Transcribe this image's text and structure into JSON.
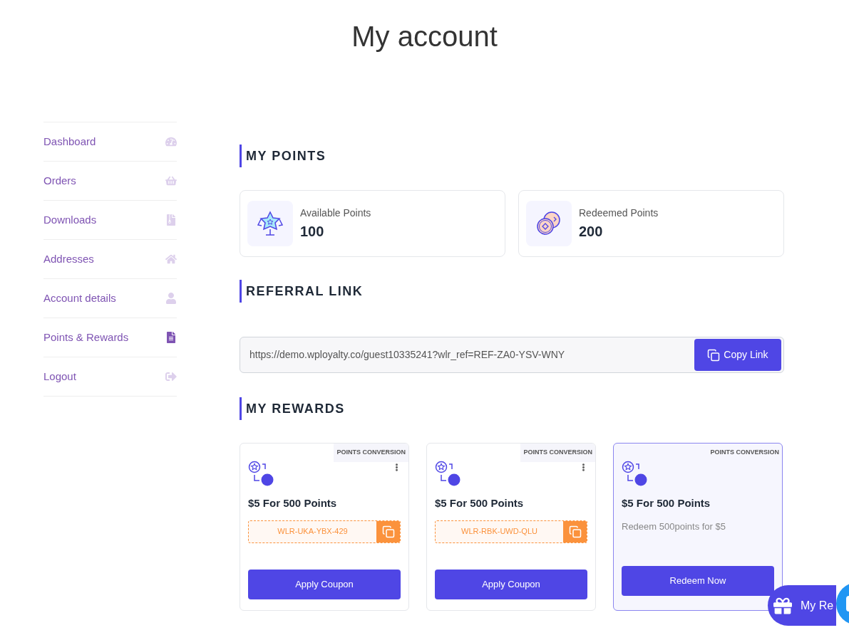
{
  "page_title": "My account",
  "sidebar": {
    "items": [
      {
        "label": "Dashboard",
        "selected": false
      },
      {
        "label": "Orders",
        "selected": false
      },
      {
        "label": "Downloads",
        "selected": false
      },
      {
        "label": "Addresses",
        "selected": false
      },
      {
        "label": "Account details",
        "selected": false
      },
      {
        "label": "Points & Rewards",
        "selected": true
      },
      {
        "label": "Logout",
        "selected": false
      }
    ]
  },
  "my_points": {
    "heading": "MY POINTS",
    "cards": [
      {
        "kind": "available",
        "label": "Available Points",
        "value": "100"
      },
      {
        "kind": "redeemed",
        "label": "Redeemed Points",
        "value": "200"
      }
    ]
  },
  "referral": {
    "heading": "REFERRAL LINK",
    "link": "https://demo.wployalty.co/guest10335241?wlr_ref=REF-ZA0-YSV-WNY",
    "button": "Copy Link"
  },
  "my_rewards": {
    "heading": "MY REWARDS",
    "cards": [
      {
        "kind": "coupon",
        "tag": "POINTS CONVERSION",
        "title": "$5 For 500 Points",
        "code": "WLR-UKA-YBX-429",
        "button": "Apply Coupon",
        "selected": false
      },
      {
        "kind": "coupon",
        "tag": "POINTS CONVERSION",
        "title": "$5 For 500 Points",
        "code": "WLR-RBK-UWD-QLU",
        "button": "Apply Coupon",
        "selected": false
      },
      {
        "kind": "redeem",
        "tag": "POINTS CONVERSION",
        "title": "$5 For 500 Points",
        "description": "Redeem 500points for $5",
        "button": "Redeem Now",
        "selected": true
      }
    ]
  },
  "floating_button": {
    "label": "My Re"
  }
}
